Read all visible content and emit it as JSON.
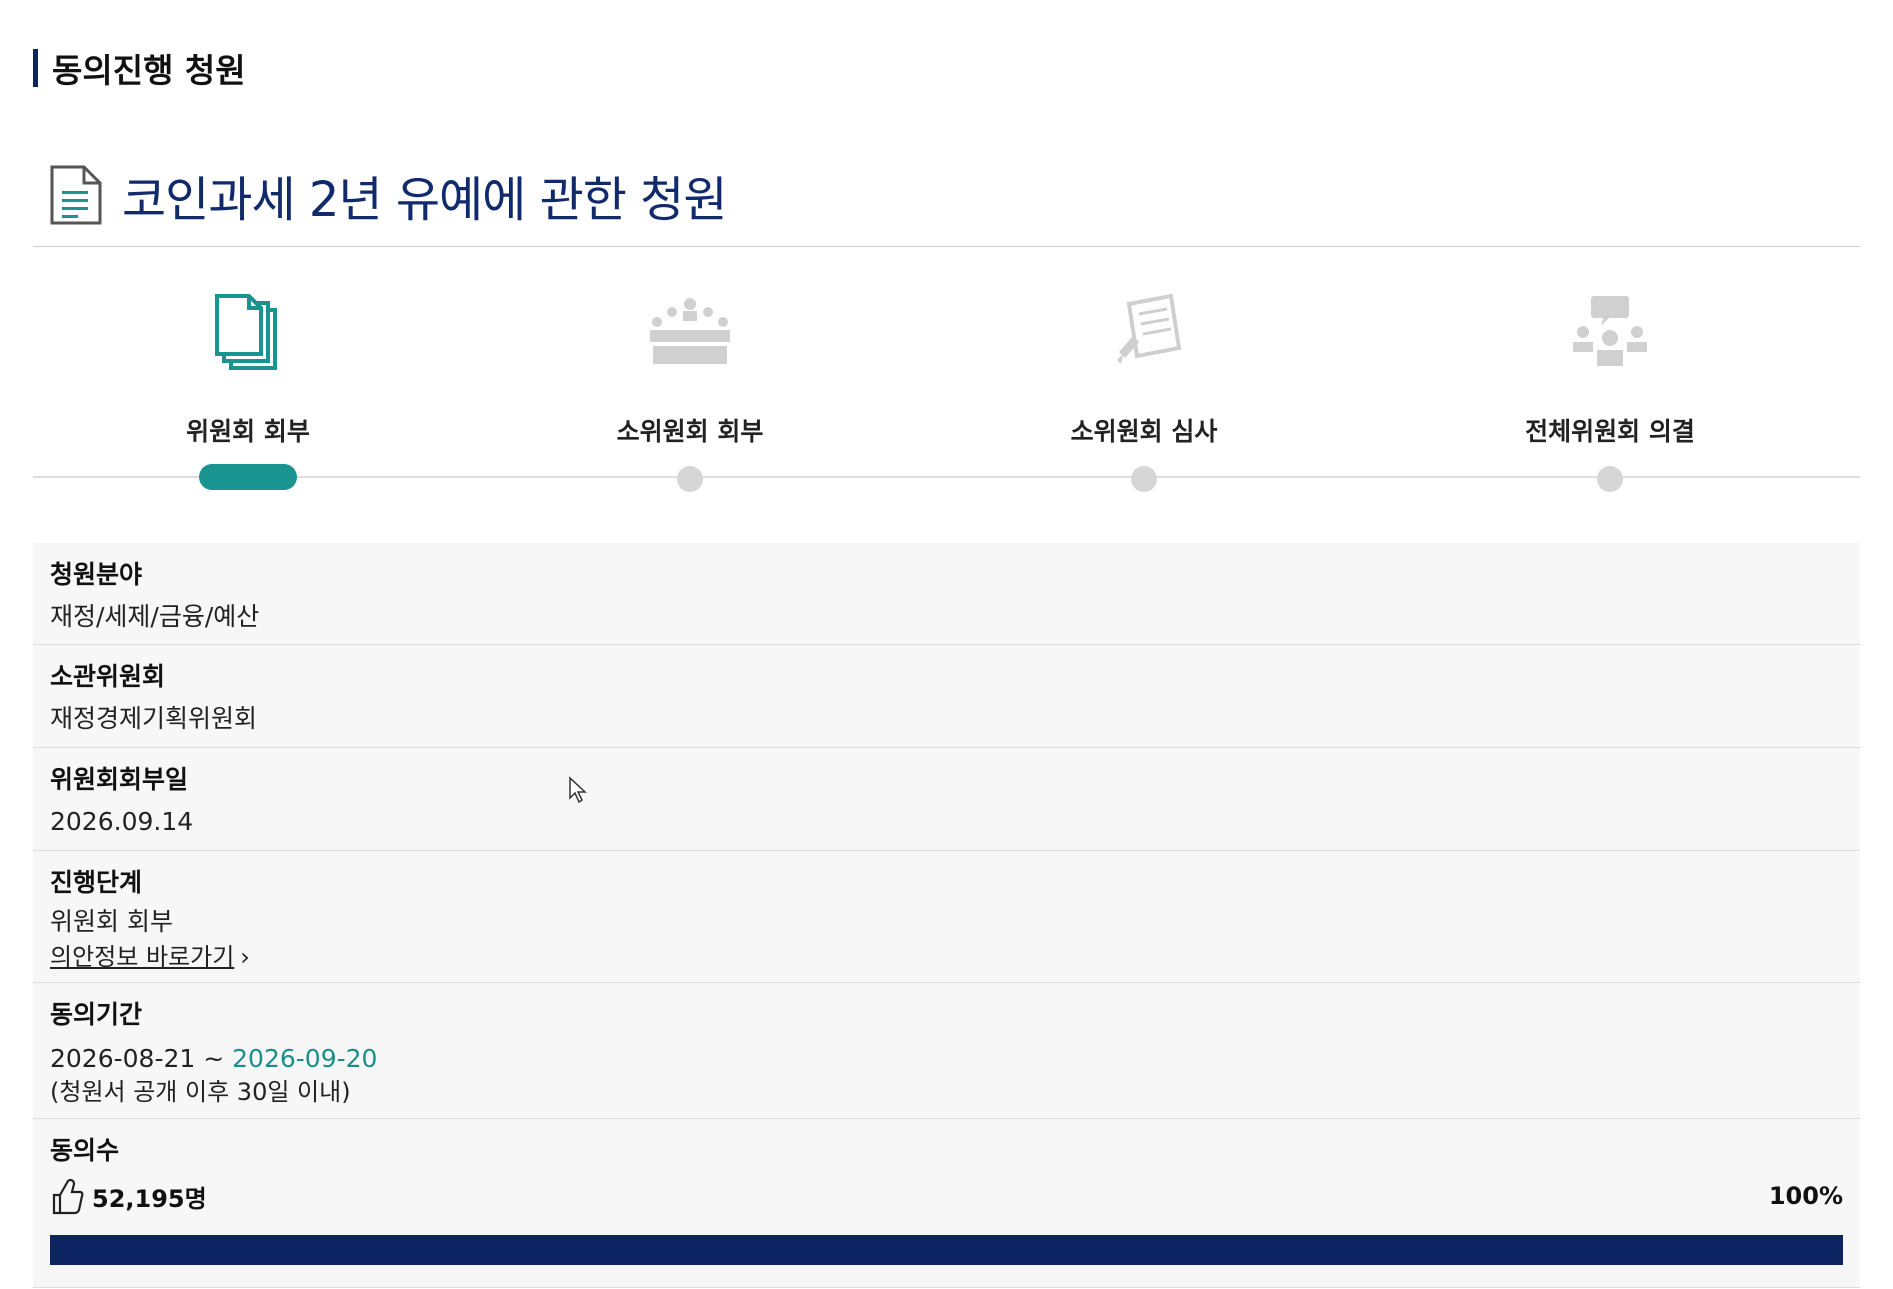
{
  "section_heading": "동의진행 청원",
  "petition": {
    "title": "코인과세 2년 유예에 관한 청원"
  },
  "steps": [
    {
      "label": "위원회 회부",
      "icon": "documents-icon",
      "active": true
    },
    {
      "label": "소위원회 회부",
      "icon": "meeting-room-icon",
      "active": false
    },
    {
      "label": "소위원회 심사",
      "icon": "review-document-icon",
      "active": false
    },
    {
      "label": "전체위원회 의결",
      "icon": "discussion-people-icon",
      "active": false
    }
  ],
  "info": {
    "field": {
      "label": "청원분야",
      "value": "재정/세제/금융/예산"
    },
    "committee": {
      "label": "소관위원회",
      "value": "재정경제기획위원회"
    },
    "referral_date": {
      "label": "위원회회부일",
      "value": "2026.09.14"
    },
    "stage": {
      "label": "진행단계",
      "value": "위원회 회부",
      "link": "의안정보 바로가기"
    },
    "period": {
      "label": "동의기간",
      "start": "2026-08-21",
      "separator": "~",
      "end": "2026-09-20",
      "note": "(청원서 공개 이후 30일 이내)"
    },
    "agreement": {
      "label": "동의수",
      "count": "52,195명",
      "percent": "100%",
      "progress": 1.0
    }
  },
  "colors": {
    "accent_teal": "#1a9490",
    "navy": "#0c2461",
    "inactive": "#d6d6d6"
  }
}
